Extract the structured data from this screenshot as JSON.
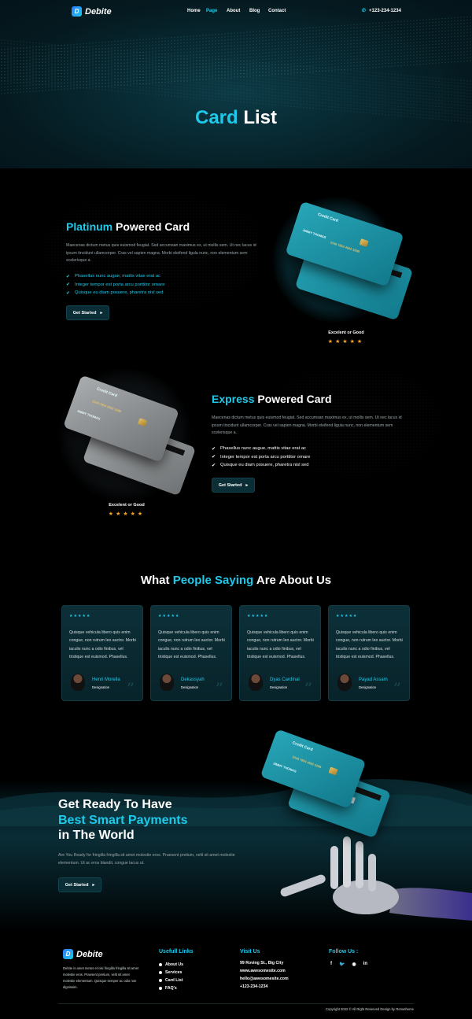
{
  "brand": {
    "name": "Debite",
    "badge": "D"
  },
  "nav": {
    "items": [
      {
        "label": "Home",
        "active": false
      },
      {
        "label": "Page",
        "active": true
      },
      {
        "label": "About",
        "active": false
      },
      {
        "label": "Blog",
        "active": false
      },
      {
        "label": "Contact",
        "active": false
      }
    ],
    "phone": "+123-234-1234",
    "phone_icon": "phone-icon"
  },
  "hero": {
    "title_accent": "Card",
    "title_rest": "List"
  },
  "platinum": {
    "title_accent": "Platinum",
    "title_rest": "Powered Card",
    "description": "Maecenas dictum metus quis euismod feugiat. Sed accumsan maximus ex, ut mollis sem. Ut nec lacus id ipsum tincidunt ullamcorper. Cras vel sapien magna. Morbi eleifend ligula nunc, non elementum sem scelerisque a.",
    "features": [
      "Phasellus nunc augue, mattis vitae erat ac",
      "Integer tempor est porta arcu porttitor ornare",
      "Quisque eu diam posuere, pharetra nisl sed"
    ],
    "button": "Get Started",
    "card_label": "Credit Card",
    "card_number": "3349 7854 4592 3298",
    "card_holder": "JIMMY THOMAS",
    "rating_label": "Excelent or Good",
    "stars": "★★★★★"
  },
  "express": {
    "title_accent": "Express",
    "title_rest": "Powered Card",
    "description": "Maecenas dictum metus quis euismod feugiat. Sed accumsan maximus ex, ut mollis sem. Ut nec lacus id ipsum tincidunt ullamcorper. Cras vel sapien magna. Morbi eleifend ligula nunc, non elementum sem scelerisque a.",
    "features": [
      "Phasellus nunc augue, mattis vitae erat ac",
      "Integer tempor est porta arcu porttitor ornare",
      "Quisque eu diam posuere, pharetra nisl sed"
    ],
    "button": "Get Started",
    "card_label": "Credit Card",
    "card_number": "3349 7854 4592 3298",
    "card_holder": "JIMMY THOMAS",
    "rating_label": "Excelent or Good",
    "stars": "★★★★★"
  },
  "testimonials": {
    "title_pre": "What",
    "title_accent": "People Saying",
    "title_post": "Are About Us",
    "items": [
      {
        "stars": "★★★★★",
        "quote": "Quisque vehicula libero quis enim congue, non rutrum leo auctor. Morbi iaculis nunc a odio finibus, vel tristique est euismod. Phasellus.",
        "name": "Henri Morella",
        "designation": "Designation"
      },
      {
        "stars": "★★★★★",
        "quote": "Quisque vehicula libero quis enim congue, non rutrum leo auctor. Morbi iaculis nunc a odio finibus, vel tristique est euismod. Phasellus.",
        "name": "Dekassyah",
        "designation": "Designation"
      },
      {
        "stars": "★★★★★",
        "quote": "Quisque vehicula libero quis enim congue, non rutrum leo auctor. Morbi iaculis nunc a odio finibus, vel tristique est euismod. Phasellus.",
        "name": "Dyas Cardinal",
        "designation": "Designation"
      },
      {
        "stars": "★★★★★",
        "quote": "Quisque vehicula libero quis enim congue, non rutrum leo auctor. Morbi iaculis nunc a odio finibus, vel tristique est euismod. Phasellus.",
        "name": "Payad Assam",
        "designation": "Designation"
      }
    ]
  },
  "cta": {
    "line1": "Get Ready To Have",
    "line2_accent": "Best Smart Payments",
    "line3": "in The World",
    "description": "Are You Ready for fringilla fringilla sit amet molestie eros. Praesent pretium, velit sit amet molestie elementum.  Ut ac eros blandit, congue lacus ut.",
    "button": "Get Started",
    "card_label": "Credit Card",
    "card_number": "3349 7854 4592 3298",
    "card_holder": "JIMMY THOMAS"
  },
  "footer": {
    "about": "Debite is amet metus et nisi fringilla fringilla sit amet molestie eros. Praesent pretium, velit sit amet molestie elementum. Quisque semper ac odio non dignissim.",
    "links_title": "Usefull Links",
    "links": [
      "About Us",
      "Services",
      "Card List",
      "FAQ's"
    ],
    "visit_title": "Visit Us",
    "address": "99 Roving St., Big City",
    "website": "www.awesomesite.com",
    "email": "hello@awesomesite.com",
    "phone": "+123-234-1234",
    "follow_title": "Follow Us :",
    "social": [
      "facebook-icon",
      "twitter-icon",
      "instagram-icon",
      "linkedin-icon"
    ],
    "copyright": "Copyright 2022 © All Right Reserved Design by Rometheme"
  }
}
